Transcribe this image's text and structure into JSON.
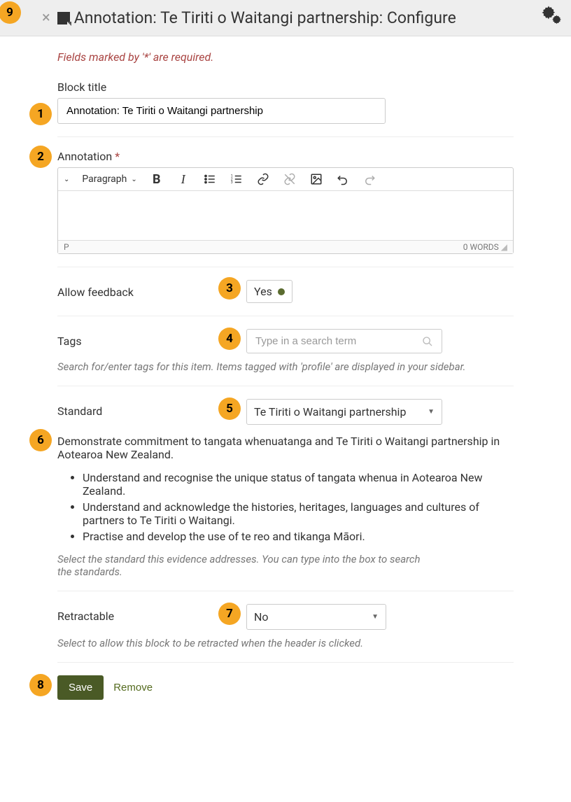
{
  "header": {
    "title": "Annotation: Te Tiriti o Waitangi partnership: Configure"
  },
  "required_note": "Fields marked by '*' are required.",
  "block_title": {
    "label": "Block title",
    "value": "Annotation: Te Tiriti o Waitangi partnership"
  },
  "annotation": {
    "label": "Annotation",
    "required": "*",
    "format_label": "Paragraph",
    "status_left": "P",
    "status_right": "0 WORDS"
  },
  "allow_feedback": {
    "label": "Allow feedback",
    "value": "Yes"
  },
  "tags": {
    "label": "Tags",
    "placeholder": "Type in a search term",
    "help": "Search for/enter tags for this item. Items tagged with 'profile' are displayed in your sidebar."
  },
  "standard": {
    "label": "Standard",
    "value": "Te Tiriti o Waitangi partnership",
    "description": "Demonstrate commitment to tangata whenuatanga and Te Tiriti o Waitangi partnership in Aotearoa New Zealand.",
    "bullets": [
      "Understand and recognise the unique status of tangata whenua in Aotearoa New Zealand.",
      "Understand and acknowledge the histories, heritages, languages and cultures of partners to Te Tiriti o Waitangi.",
      "Practise and develop the use of te reo and tikanga Māori."
    ],
    "help": "Select the standard this evidence addresses. You can type into the box to search the standards."
  },
  "retractable": {
    "label": "Retractable",
    "value": "No",
    "help": "Select to allow this block to be retracted when the header is clicked."
  },
  "buttons": {
    "save": "Save",
    "remove": "Remove"
  },
  "markers": {
    "1": "1",
    "2": "2",
    "3": "3",
    "4": "4",
    "5": "5",
    "6": "6",
    "7": "7",
    "8": "8",
    "9": "9"
  }
}
